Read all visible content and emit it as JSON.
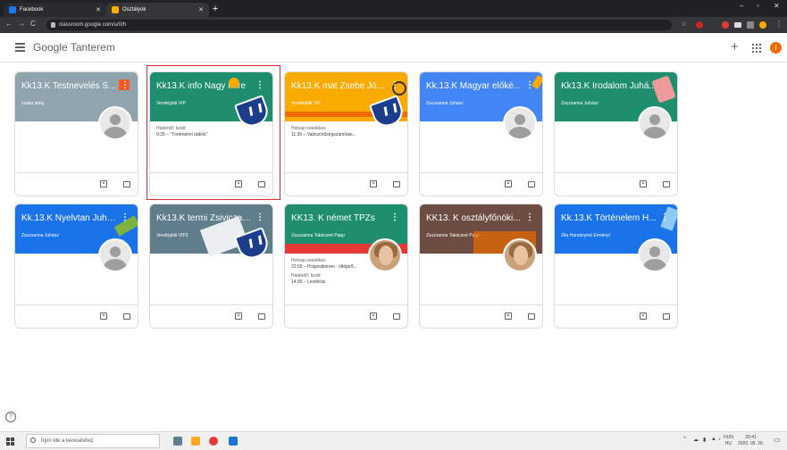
{
  "browser": {
    "tabs": [
      {
        "label": "Facebook",
        "favicon_color": "#1877f2"
      },
      {
        "label": "Osztályok",
        "favicon_color": "#f9ab00"
      }
    ],
    "url": "classroom.google.com/u/0/h"
  },
  "app": {
    "logo_google": "Google",
    "logo_product": "Tanterem",
    "create_label": "+",
    "account_initial": "I"
  },
  "cards": [
    {
      "title": "Kk13.K Testnevelés St...",
      "subtitle": "csaba steig",
      "color": "#90a4ae",
      "info_label": "",
      "info_text": "",
      "info_label2": "",
      "info_text2": ""
    },
    {
      "title": "Kk13.K info Nagy Imre",
      "subtitle": "Vendégláti VIP",
      "color": "#1e8e6e",
      "info_label": "Határidő: kedd",
      "info_text": "9:35 – \"Történelmi rádiók\"",
      "info_label2": "",
      "info_text2": ""
    },
    {
      "title": "Kk13.K mat Zsebe Józ...",
      "subtitle": "Vendégláti VIP",
      "color": "#f9ab00",
      "info_label": "Holnap esedékes",
      "info_text": "11:30 – Valószínűségszámítási...",
      "info_label2": "",
      "info_text2": ""
    },
    {
      "title": "Kk.13.K Magyar előké...",
      "subtitle": "Zsuzsanna Juhász",
      "color": "#4285f4",
      "info_label": "",
      "info_text": "",
      "info_label2": "",
      "info_text2": ""
    },
    {
      "title": "Kk13.K Irodalom Juhá...",
      "subtitle": "Zsuzsanna Juhász",
      "color": "#1e8e6e",
      "info_label": "",
      "info_text": "",
      "info_label2": "",
      "info_text2": ""
    },
    {
      "title": "Kk.13.K Nyelvtan Juhá...",
      "subtitle": "Zsuzsanna Juhász",
      "color": "#1a73e8",
      "info_label": "",
      "info_text": "",
      "info_label2": "",
      "info_text2": ""
    },
    {
      "title": "Kk13.K termi Zsivicza J...",
      "subtitle": "Vendégláti VIP2",
      "color": "#607d8b",
      "info_label": "",
      "info_text": "",
      "info_label2": "",
      "info_text2": ""
    },
    {
      "title": "KK13. K német TPZs",
      "subtitle": "Zsuzsanna Takácsné Papp",
      "color": "#1e8e6e",
      "info_label": "Holnap esedékes",
      "info_text": "23:59 – Präpositionen - öltöjárő...",
      "info_label2": "Határidő: kedd",
      "info_text2": "14:00 – Levélírás"
    },
    {
      "title": "KK13. K osztályfőnöki...",
      "subtitle": "Zsuzsanna Takácsné Papp",
      "color": "#6d4c41",
      "info_label": "",
      "info_text": "",
      "info_label2": "",
      "info_text2": ""
    },
    {
      "title": "Kk.13.K Történelem H...",
      "subtitle": "Zita Harsányiné Erményi",
      "color": "#1a73e8",
      "info_label": "",
      "info_text": "",
      "info_label2": "",
      "info_text2": ""
    }
  ],
  "taskbar": {
    "search_placeholder": "Írjon ide a kereséshez",
    "lang_line1": "HUN",
    "lang_line2": "HU",
    "time": "20:41",
    "date": "2020. 05. 26."
  }
}
